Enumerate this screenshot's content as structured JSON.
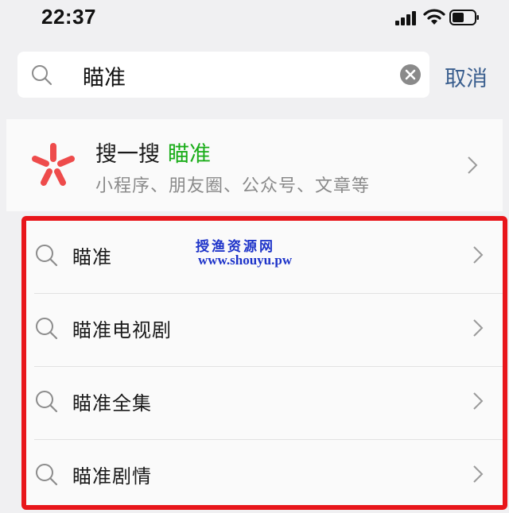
{
  "status_bar": {
    "time": "22:37"
  },
  "search": {
    "value": "瞄准",
    "cancel_label": "取消"
  },
  "sou_yi_sou": {
    "title": "搜一搜",
    "keyword": "瞄准",
    "subtitle": "小程序、朋友圈、公众号、文章等"
  },
  "suggestions": [
    {
      "label": "瞄准"
    },
    {
      "label": "瞄准电视剧"
    },
    {
      "label": "瞄准全集"
    },
    {
      "label": "瞄准剧情"
    }
  ],
  "watermark": {
    "name": "授渔资源网",
    "url": "www.shouyu.pw"
  },
  "colors": {
    "accent_green": "#1aad19",
    "cancel_blue": "#3b5f8f",
    "highlight_red": "#e8161b",
    "watermark_blue": "#1d33c9"
  }
}
